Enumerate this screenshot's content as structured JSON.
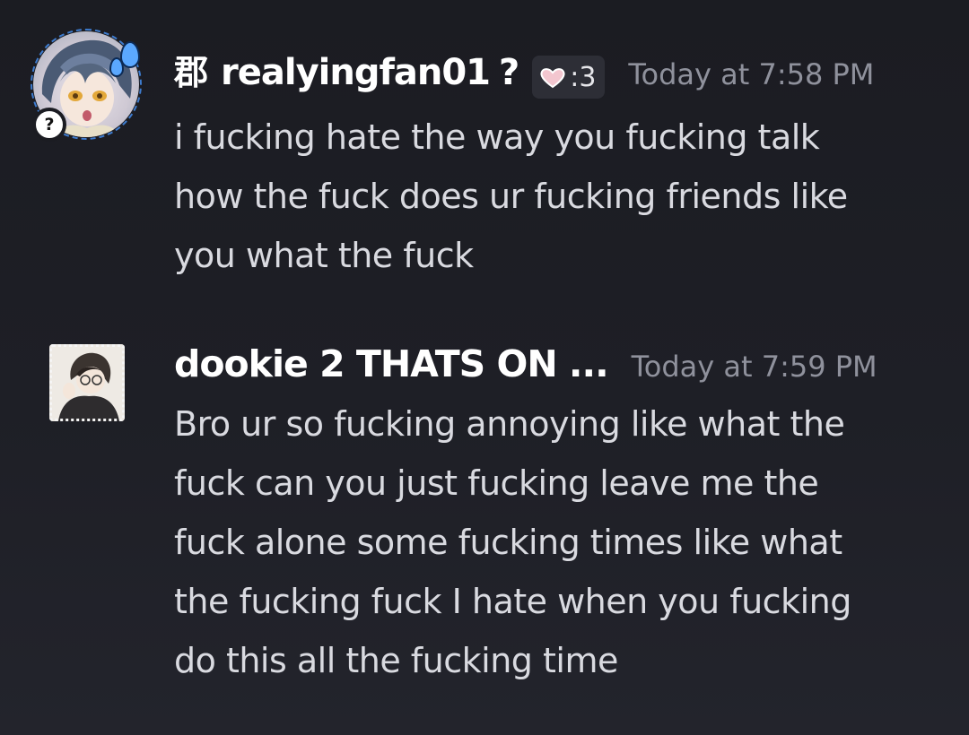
{
  "messages": [
    {
      "server_tag": "郡",
      "username": "realyingfan01",
      "status_mark": "?",
      "pill": {
        "icon": "pink-heart-icon",
        "text": ":3"
      },
      "timestamp": "Today at 7:58 PM",
      "avatar_badge": "?",
      "lines": [
        "i fucking hate the way you fucking talk",
        "how the fuck does ur fucking friends like",
        "you what the fuck"
      ]
    },
    {
      "username": "dookie 2 THATS ON ...",
      "timestamp": "Today at 7:59 PM",
      "lines": [
        "Bro ur so fucking annoying like what the",
        "fuck can you just fucking leave me the",
        "fuck alone some fucking times like what",
        "the fucking fuck I hate when you fucking",
        "do this all the fucking time"
      ]
    }
  ],
  "colors": {
    "background": "#1e1f26",
    "username": "#ffffff",
    "timestamp": "#8f919c",
    "body_text": "#d9dae0",
    "avatar_ring": "#3e7ccf",
    "pill_bg": "#2d2e36",
    "heart": "#f3c6cf"
  }
}
